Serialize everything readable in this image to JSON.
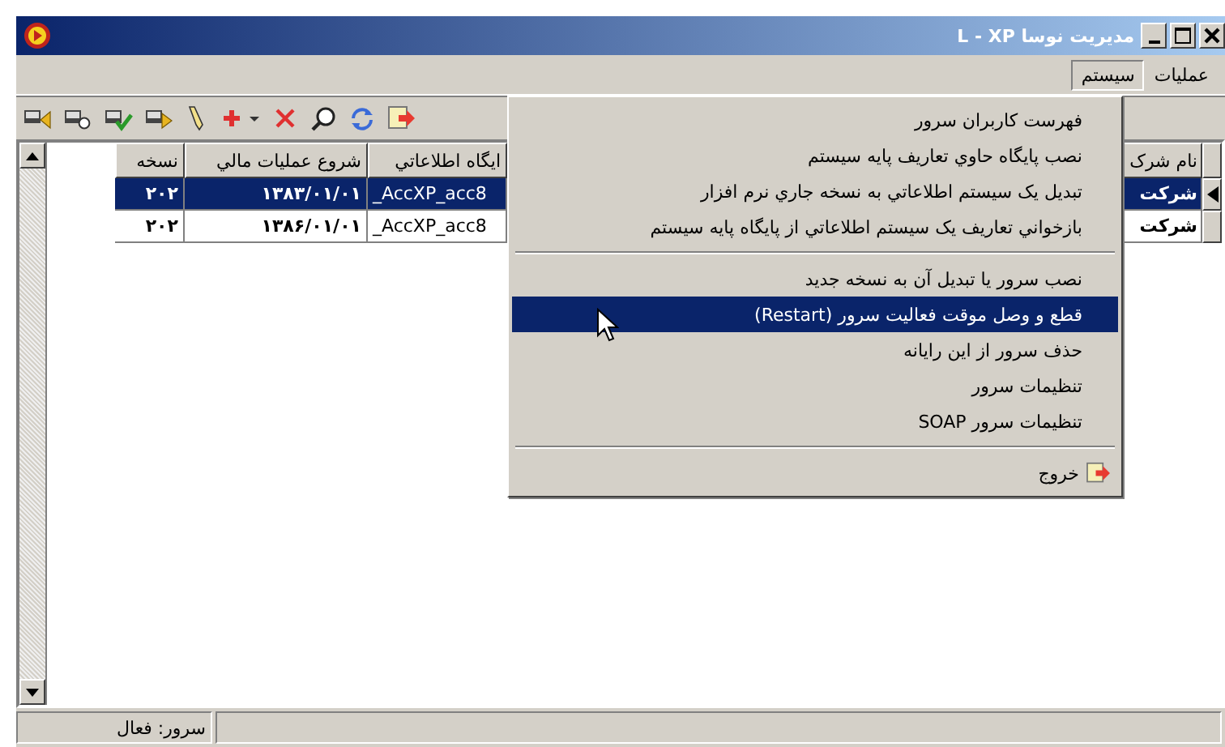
{
  "window": {
    "title": "مديريت نوسا L - XP"
  },
  "menu_bar": [
    {
      "label": "عمليات",
      "selected": false
    },
    {
      "label": "سيستم",
      "selected": true
    }
  ],
  "table": {
    "columns": [
      {
        "label": "نام شرک"
      },
      {
        "label": "ايگاه اطلاعاتي"
      },
      {
        "label": "شروع عمليات مالي"
      },
      {
        "label": "نسخه"
      }
    ],
    "rows": [
      {
        "selected": true,
        "cells": [
          "شرکت",
          "_AccXP_acc8",
          "۱۳۸۳/۰۱/۰۱",
          "۲۰۲"
        ]
      },
      {
        "selected": false,
        "cells": [
          "شرکت",
          "_AccXP_acc8",
          "۱۳۸۶/۰۱/۰۱",
          "۲۰۲"
        ]
      }
    ]
  },
  "dropdown_menu": [
    {
      "kind": "item",
      "label": "فهرست کاربران سرور",
      "selected": false
    },
    {
      "kind": "item",
      "label": "نصب پايگاه حاوي تعاريف پايه سيستم",
      "selected": false
    },
    {
      "kind": "item",
      "label": "تبديل يک سيستم اطلاعاتي به نسخه جاري نرم افزار",
      "selected": false
    },
    {
      "kind": "item",
      "label": "بازخواني تعاريف يک سيستم اطلاعاتي از پايگاه پايه سيستم",
      "selected": false
    },
    {
      "kind": "separator"
    },
    {
      "kind": "item",
      "label": "نصب سرور يا تبديل آن به نسخه جديد",
      "selected": false
    },
    {
      "kind": "item",
      "label": "قطع و وصل موقت فعاليت سرور (Restart)",
      "selected": true
    },
    {
      "kind": "item",
      "label": "حذف سرور از اين رايانه",
      "selected": false
    },
    {
      "kind": "item",
      "label": "تنظيمات سرور",
      "selected": false
    },
    {
      "kind": "item",
      "label": "تنظيمات سرور SOAP",
      "selected": false
    },
    {
      "kind": "separator"
    },
    {
      "kind": "exit",
      "label": "خروج",
      "selected": false
    }
  ],
  "status_bar": {
    "server_status": "سرور: فعال"
  }
}
